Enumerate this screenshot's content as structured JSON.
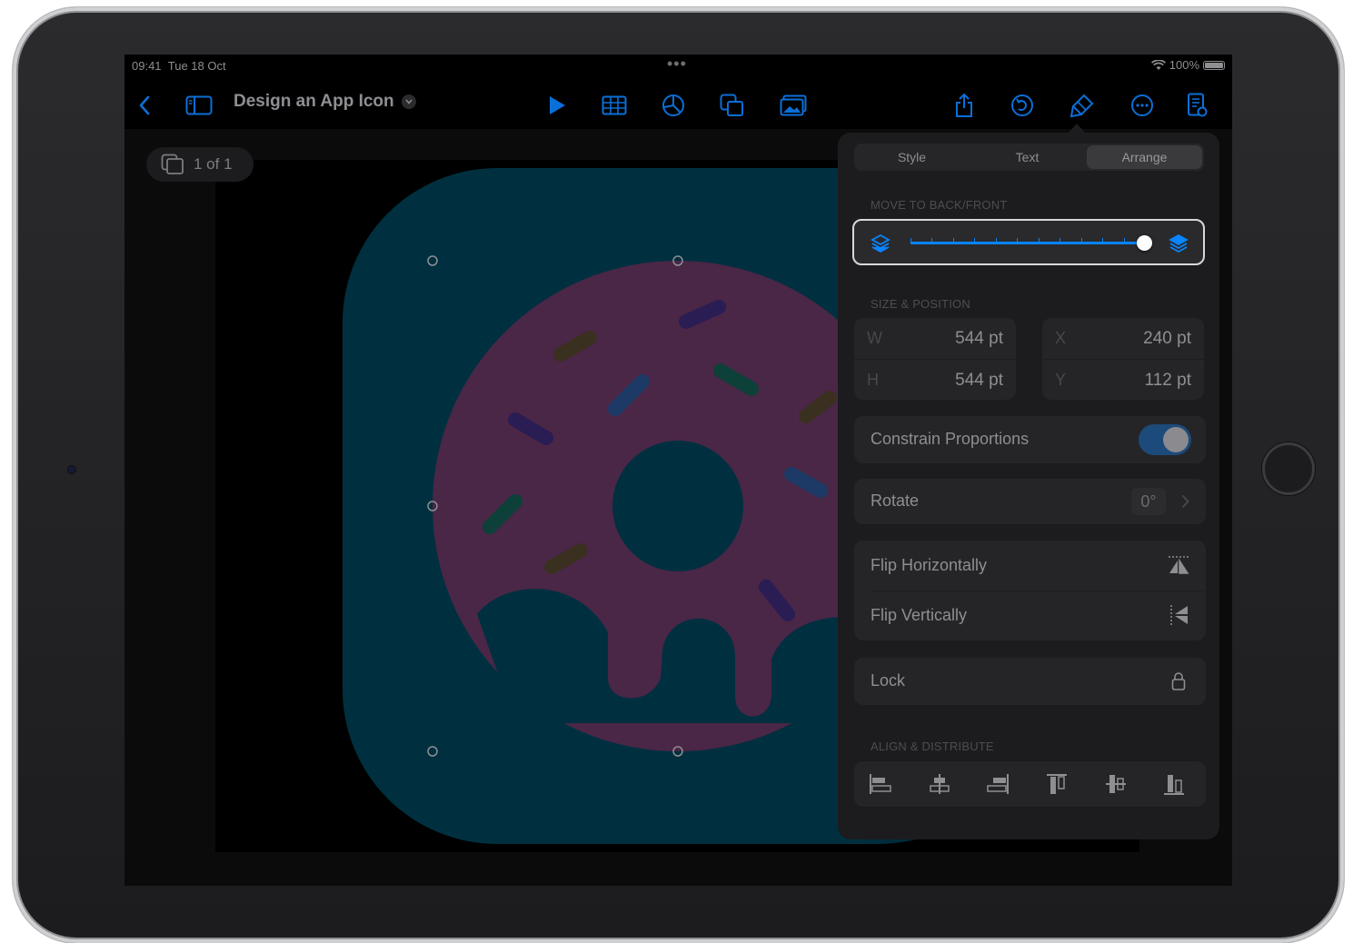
{
  "status": {
    "time": "09:41",
    "date": "Tue 18 Oct",
    "battery": "100%"
  },
  "toolbar": {
    "doc_title": "Design an App Icon"
  },
  "navigator": {
    "page_indicator": "1 of 1"
  },
  "inspector": {
    "tabs": [
      {
        "label": "Style",
        "selected": false
      },
      {
        "label": "Text",
        "selected": false
      },
      {
        "label": "Arrange",
        "selected": true
      }
    ],
    "move_section": "MOVE TO BACK/FRONT",
    "slider_value": 1.0,
    "size_section": "SIZE & POSITION",
    "w_key": "W",
    "w_value": "544 pt",
    "h_key": "H",
    "h_value": "544 pt",
    "x_key": "X",
    "x_value": "240 pt",
    "y_key": "Y",
    "y_value": "112 pt",
    "constrain_label": "Constrain Proportions",
    "constrain_on": true,
    "rotate_label": "Rotate",
    "rotate_value": "0°",
    "flip_h_label": "Flip Horizontally",
    "flip_v_label": "Flip Vertically",
    "lock_label": "Lock",
    "align_section": "ALIGN & DISTRIBUTE"
  },
  "colors": {
    "accent": "#0a84ff",
    "icon_bg": "#00303f",
    "donut": "#4a2647",
    "hole": "#003040"
  }
}
